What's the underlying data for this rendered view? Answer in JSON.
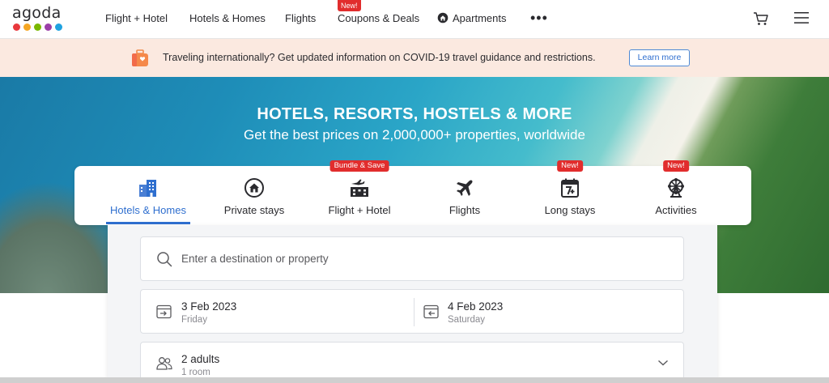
{
  "brand": {
    "logo_text": "agoda",
    "dot_colors": [
      "#e8383d",
      "#f5a623",
      "#7ab800",
      "#9b3fa8",
      "#1fa2e0"
    ]
  },
  "nav": {
    "items": [
      {
        "label": "Flight + Hotel"
      },
      {
        "label": "Hotels & Homes"
      },
      {
        "label": "Flights"
      },
      {
        "label": "Coupons & Deals",
        "badge": "New!"
      },
      {
        "label": "Apartments"
      }
    ],
    "more_icon": "more-dots-icon",
    "cart_icon": "cart-icon",
    "menu_icon": "hamburger-menu-icon"
  },
  "notice": {
    "text": "Traveling internationally? Get updated information on COVID-19 travel guidance and restrictions.",
    "button": "Learn more"
  },
  "hero": {
    "title": "HOTELS, RESORTS, HOSTELS & MORE",
    "subtitle": "Get the best prices on 2,000,000+ properties, worldwide"
  },
  "tabs": [
    {
      "label": "Hotels & Homes",
      "icon": "buildings-icon",
      "active": true
    },
    {
      "label": "Private stays",
      "icon": "house-icon"
    },
    {
      "label": "Flight + Hotel",
      "icon": "plane-building-icon",
      "badge": "Bundle & Save"
    },
    {
      "label": "Flights",
      "icon": "plane-icon"
    },
    {
      "label": "Long stays",
      "icon": "calendar-7plus-icon",
      "badge": "New!"
    },
    {
      "label": "Activities",
      "icon": "ferris-wheel-icon",
      "badge": "New!"
    }
  ],
  "search": {
    "destination_placeholder": "Enter a destination or property",
    "checkin": {
      "date": "3 Feb 2023",
      "day": "Friday"
    },
    "checkout": {
      "date": "4 Feb 2023",
      "day": "Saturday"
    },
    "guests": {
      "main": "2 adults",
      "sub": "1 room"
    }
  },
  "colors": {
    "accent": "#2f6fcf",
    "badge": "#e12d2d",
    "notice_bg": "#fbe9e0"
  }
}
